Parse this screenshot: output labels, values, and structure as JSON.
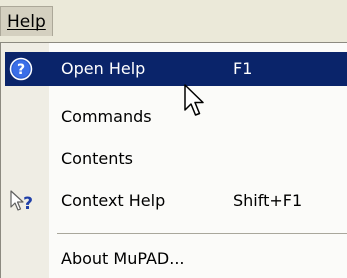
{
  "menubar": {
    "help_label": "Help"
  },
  "menu": {
    "items": [
      {
        "label": "Open Help",
        "shortcut": "F1",
        "icon": "help-circle-icon",
        "highlighted": true
      },
      {
        "label": "Commands",
        "shortcut": "",
        "icon": "",
        "highlighted": false
      },
      {
        "label": "Contents",
        "shortcut": "",
        "icon": "",
        "highlighted": false
      },
      {
        "label": "Context Help",
        "shortcut": "Shift+F1",
        "icon": "context-help-arrow-icon",
        "highlighted": false
      },
      {
        "label": "About MuPAD...",
        "shortcut": "",
        "icon": "",
        "highlighted": false
      }
    ]
  },
  "colors": {
    "highlight": "#0a246a",
    "help_icon": "#2f5fd0"
  }
}
